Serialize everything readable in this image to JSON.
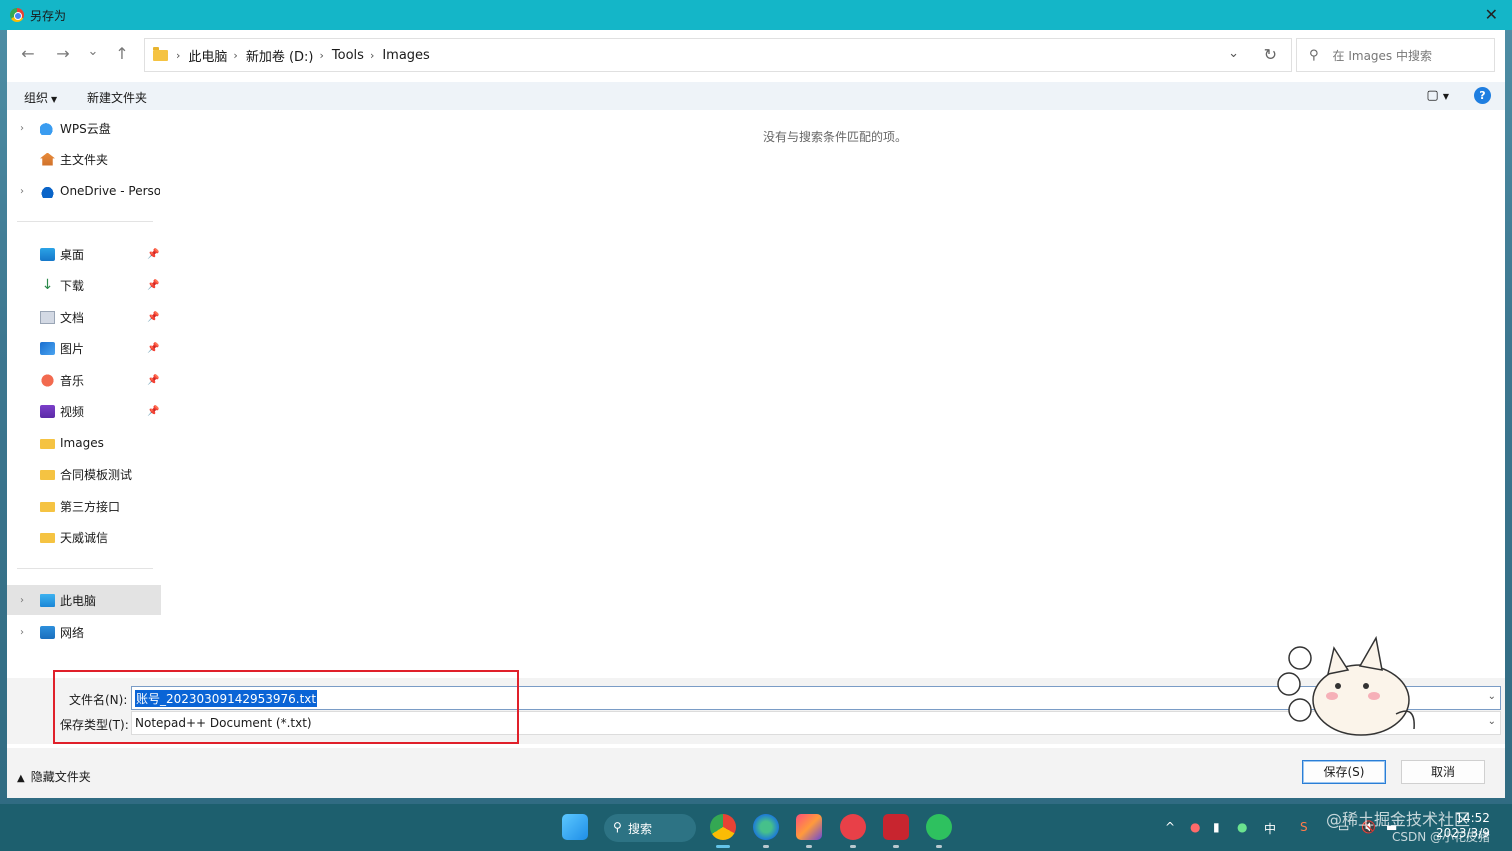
{
  "window": {
    "title": "另存为",
    "close_glyph": "✕"
  },
  "nav_buttons": {
    "back": "←",
    "forward": "→",
    "recent": "⌄",
    "up": "↑"
  },
  "address_bar": {
    "crumbs": [
      "此电脑",
      "新加卷 (D:)",
      "Tools",
      "Images"
    ],
    "separator": "›",
    "dropdown_glyph": "⌄",
    "refresh_glyph": "↻"
  },
  "search": {
    "placeholder": "在 Images 中搜索",
    "icon_glyph": "⚲"
  },
  "command_bar": {
    "organize": "组织",
    "new_folder": "新建文件夹",
    "view_glyph": "▢",
    "help_glyph": "?"
  },
  "sidebar": {
    "quick": [
      {
        "label": "WPS云盘",
        "icon": "wps-cloud-icon"
      },
      {
        "label": "主文件夹",
        "icon": "home-icon"
      },
      {
        "label": "OneDrive - Personal",
        "icon": "onedrive-icon"
      }
    ],
    "pinned": [
      {
        "label": "桌面",
        "icon": "desktop-icon"
      },
      {
        "label": "下载",
        "icon": "download-icon"
      },
      {
        "label": "文档",
        "icon": "documents-icon"
      },
      {
        "label": "图片",
        "icon": "pictures-icon"
      },
      {
        "label": "音乐",
        "icon": "music-icon"
      },
      {
        "label": "视频",
        "icon": "video-icon"
      }
    ],
    "folders": [
      {
        "label": "Images"
      },
      {
        "label": "合同模板测试"
      },
      {
        "label": "第三方接口"
      },
      {
        "label": "天威诚信"
      }
    ],
    "this_pc": "此电脑",
    "network": "网络",
    "pin_glyph": "📌",
    "expand_glyph": "›"
  },
  "content": {
    "empty_message": "没有与搜索条件匹配的项。"
  },
  "form": {
    "filename_label": "文件名(N):",
    "filename_value": "账号_20230309142953976.txt",
    "filetype_label": "保存类型(T):",
    "filetype_value": "Notepad++ Document (*.txt)",
    "combo_glyph": "⌄"
  },
  "footer": {
    "hide_folders": "隐藏文件夹",
    "save_button": "保存(S)",
    "cancel_button": "取消"
  },
  "taskbar": {
    "search_label": "搜索",
    "tray_ime": "中",
    "time": "14:52",
    "date": "2023/3/9"
  },
  "watermarks": [
    "@稀土掘金技术社区",
    "CSDN @小花皮猪"
  ],
  "colors": {
    "titlebar": "#14b6c8",
    "selection": "#0a64d6",
    "highlight_box": "#e0202a"
  }
}
